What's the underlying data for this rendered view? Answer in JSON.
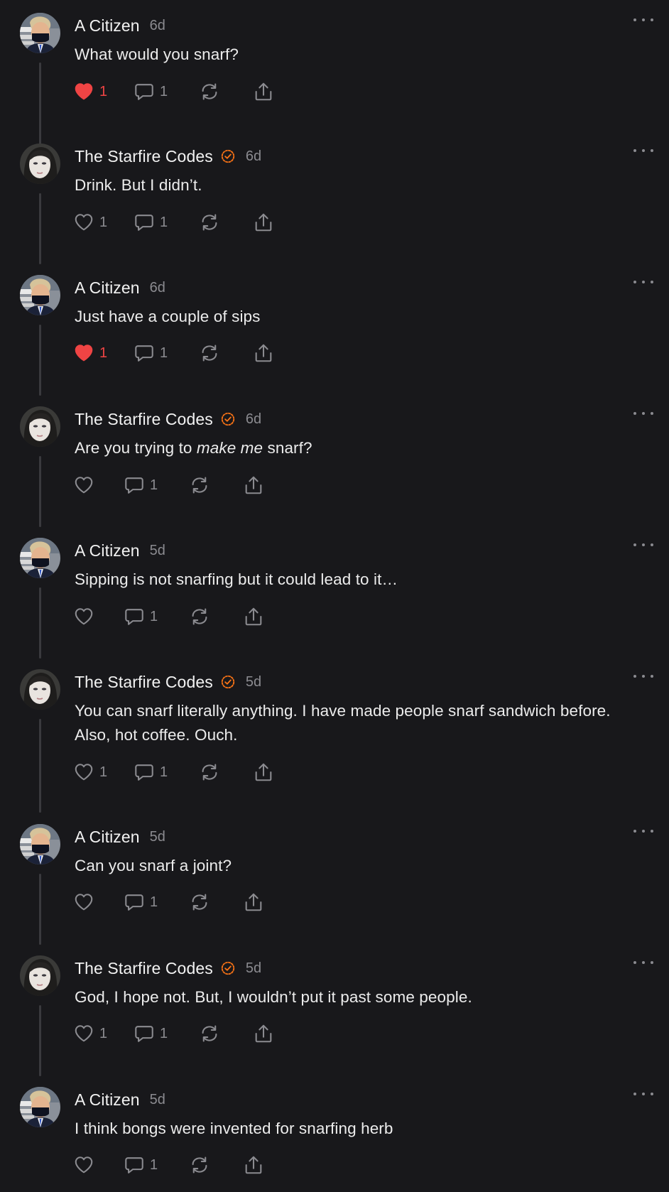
{
  "colors": {
    "background": "#18181b",
    "liked": "#ef4444",
    "verified": "#f97316",
    "muted": "#8b8b90"
  },
  "icons": {
    "like": "heart-icon",
    "liked": "heart-filled-icon",
    "reply": "comment-bubble-icon",
    "repost": "repost-arrows-icon",
    "share": "share-upload-icon",
    "more": "more-options-icon",
    "verified": "verified-check-icon"
  },
  "posts": [
    {
      "author": "A Citizen",
      "verified": false,
      "time": "6d",
      "text": "What would you snarf?",
      "liked": true,
      "like_count": "1",
      "reply_count": "1"
    },
    {
      "author": "The Starfire Codes",
      "verified": true,
      "time": "6d",
      "text": "Drink. But I didn’t.",
      "liked": false,
      "like_count": "1",
      "reply_count": "1"
    },
    {
      "author": "A Citizen",
      "verified": false,
      "time": "6d",
      "text": "Just have a couple of sips",
      "liked": true,
      "like_count": "1",
      "reply_count": "1"
    },
    {
      "author": "The Starfire Codes",
      "verified": true,
      "time": "6d",
      "text_before": "Are you trying to ",
      "text_emphasis": "make me",
      "text_after": " snarf?",
      "liked": false,
      "like_count": "",
      "reply_count": "1"
    },
    {
      "author": "A Citizen",
      "verified": false,
      "time": "5d",
      "text": "Sipping is not snarfing but it could lead to it…",
      "liked": false,
      "like_count": "",
      "reply_count": "1"
    },
    {
      "author": "The Starfire Codes",
      "verified": true,
      "time": "5d",
      "text_line1": "You can snarf literally anything. I have made people snarf sandwich before.",
      "text_line2": "Also, hot coffee. Ouch.",
      "liked": false,
      "like_count": "1",
      "reply_count": "1"
    },
    {
      "author": "A Citizen",
      "verified": false,
      "time": "5d",
      "text": "Can you snarf a joint?",
      "liked": false,
      "like_count": "",
      "reply_count": "1"
    },
    {
      "author": "The Starfire Codes",
      "verified": true,
      "time": "5d",
      "text": "God, I hope not. But, I wouldn’t put it past some people.",
      "liked": false,
      "like_count": "1",
      "reply_count": "1"
    },
    {
      "author": "A Citizen",
      "verified": false,
      "time": "5d",
      "text": "I think bongs were invented for snarfing herb",
      "liked": false,
      "like_count": "",
      "reply_count": "1"
    }
  ]
}
